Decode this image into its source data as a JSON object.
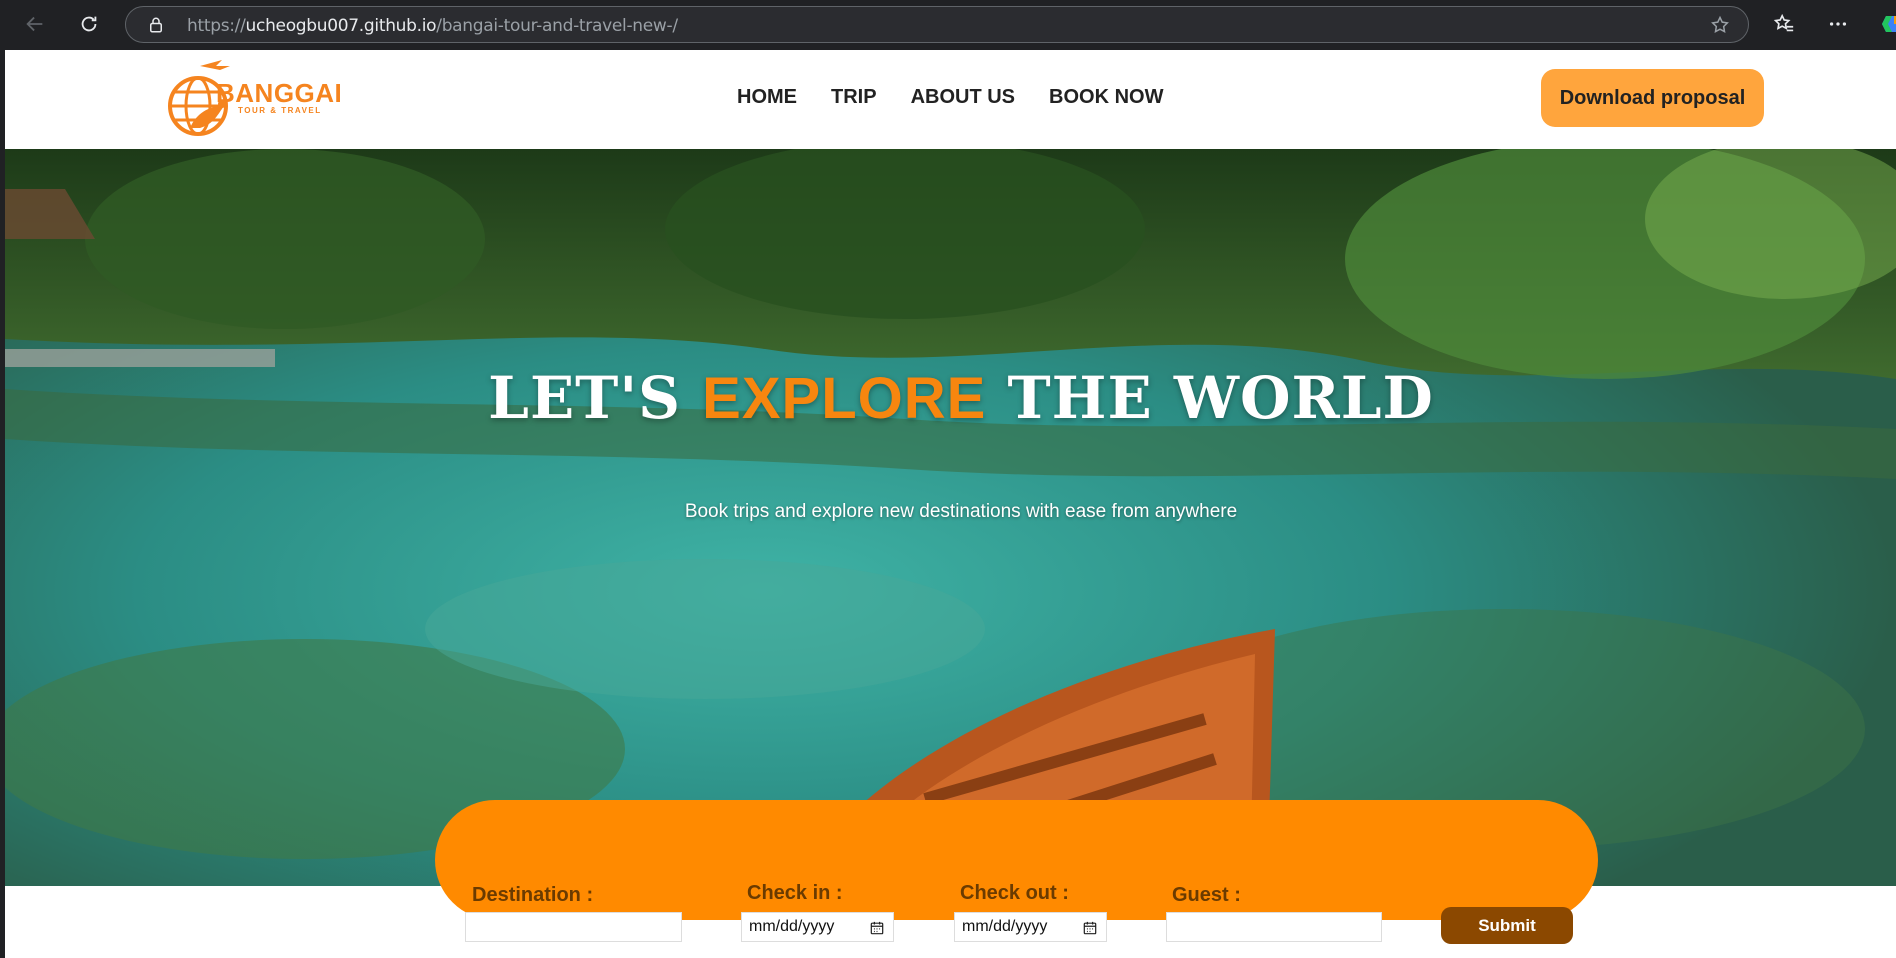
{
  "browser": {
    "url_scheme": "https://",
    "url_host": "ucheogbu007.github.io",
    "url_path": "/bangai-tour-and-travel-new-/"
  },
  "header": {
    "logo_text": "BANGGAI",
    "logo_subtext": "TOUR & TRAVEL",
    "nav": {
      "home": "HOME",
      "trip": "TRIP",
      "about": "ABOUT US",
      "book": "BOOK NOW"
    },
    "download_label": "Download proposal"
  },
  "hero": {
    "title_part1": "LET'S ",
    "title_accent": "EXPLORE",
    "title_part2": " THE WORLD",
    "subtitle": "Book trips and explore new destinations with ease from anywhere"
  },
  "booking": {
    "destination_label": "Destination :",
    "destination_value": "",
    "checkin_label": "Check in :",
    "checkin_placeholder": "mm/dd/yyyy",
    "checkout_label": "Check out :",
    "checkout_placeholder": "mm/dd/yyyy",
    "guest_label": "Guest :",
    "guest_value": "",
    "submit_label": "Submit"
  },
  "colors": {
    "accent": "#f7860f",
    "button_orange": "#ffa53d",
    "form_bg": "#ff8a00",
    "submit_bg": "#8b4800"
  }
}
